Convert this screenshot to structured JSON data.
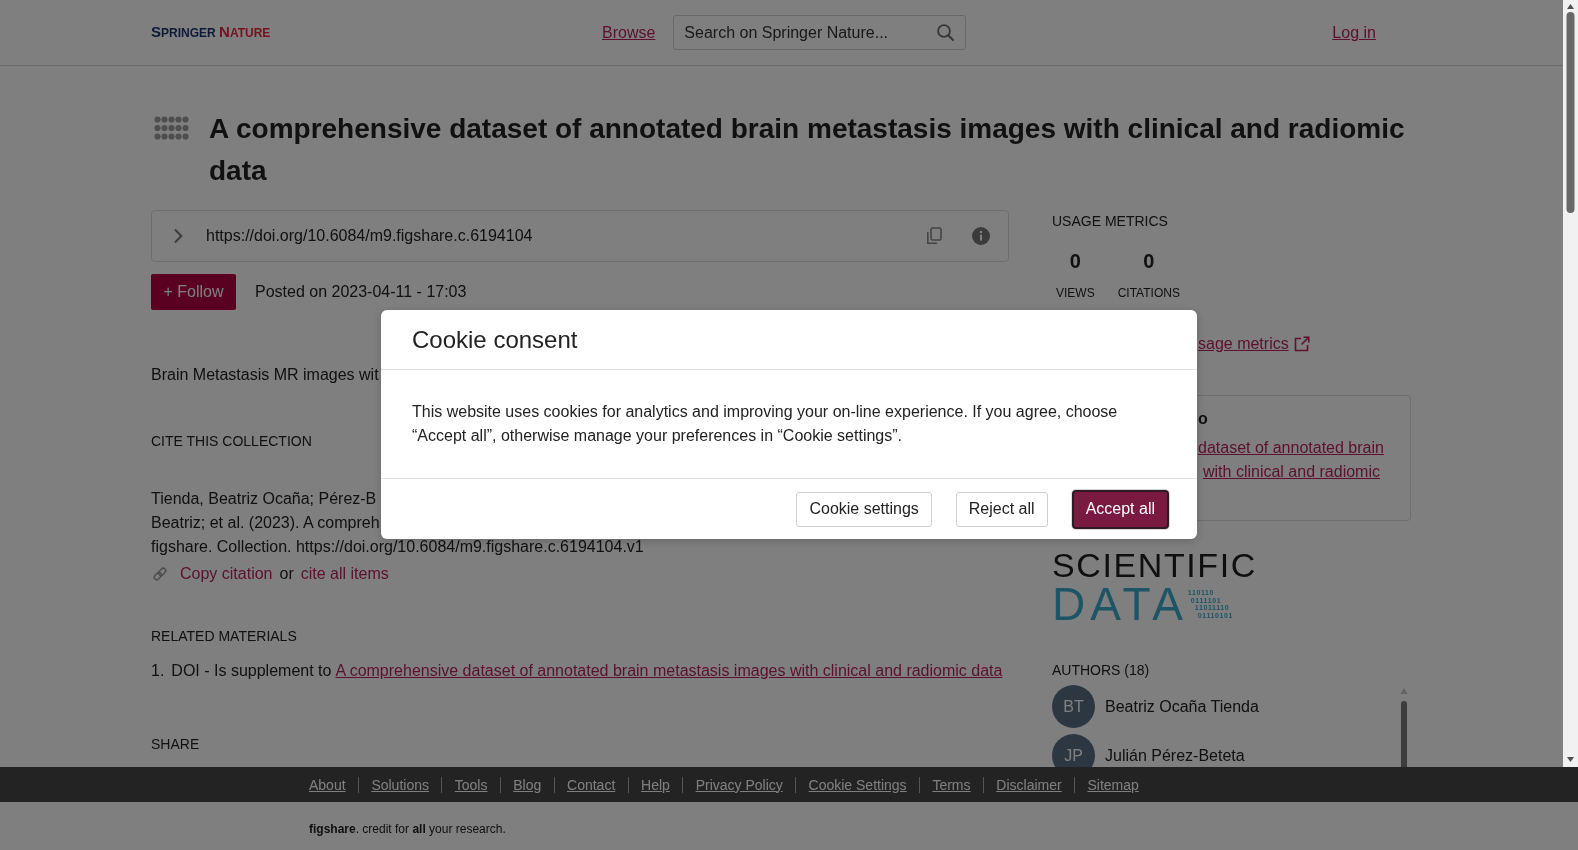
{
  "header": {
    "logo": [
      "SPRINGER",
      "NATURE"
    ],
    "browse_link": "Browse",
    "search": {
      "placeholder": "Search on Springer Nature..."
    },
    "login_link": "Log in"
  },
  "title": "A comprehensive dataset of annotated brain metastasis images with clinical and radiomic data",
  "doi_bar": {
    "url": "https://doi.org/10.6084/m9.figshare.c.6194104"
  },
  "follow_button": "+ Follow",
  "posted": "Posted on 2023-04-11 - 17:03",
  "description": "Brain Metastasis MR images wit",
  "cite": {
    "heading": "CITE THIS COLLECTION",
    "lines": [
      "Tienda, Beatriz Ocaña; Pérez-B",
      "Beatriz; et al. (2023). A compreh",
      "figshare. Collection. https://doi.org/10.6084/m9.figshare.c.6194104.v1"
    ],
    "copy_link": "Copy citation",
    "or": "or",
    "cite_all_link": "cite all items"
  },
  "related_materials": {
    "heading": "RELATED MATERIALS",
    "items": [
      {
        "number": "1.",
        "relation": "DOI - Is supplement to",
        "link": "A comprehensive dataset of annotated brain metastasis images with clinical and radiomic data"
      }
    ]
  },
  "share": {
    "heading": "SHARE"
  },
  "usage_metrics": {
    "heading": "USAGE METRICS",
    "metrics": [
      {
        "value": "0",
        "label": "VIEWS"
      },
      {
        "value": "0",
        "label": "CITATIONS"
      }
    ],
    "link": "sage metrics"
  },
  "related_card": {
    "heading": "o",
    "links": [
      "dataset of annotated brain",
      "with clinical and radiomic"
    ]
  },
  "journal_logo": {
    "top": "SCIENTIFIC",
    "bottom": "DATA",
    "binary": [
      "110110",
      "0111101",
      "11011110",
      "01110101"
    ]
  },
  "authors": {
    "heading": "AUTHORS (18)",
    "items": [
      {
        "initials": "BT",
        "name": "Beatriz Ocaña Tienda"
      },
      {
        "initials": "JP",
        "name": "Julián Pérez-Beteta"
      }
    ]
  },
  "footer": {
    "links": [
      "About",
      "Solutions",
      "Tools",
      "Blog",
      "Contact",
      "Help",
      "Privacy Policy",
      "Cookie Settings",
      "Terms",
      "Disclaimer",
      "Sitemap"
    ],
    "tagline": "**figshare**. credit for **all** your research."
  },
  "cookie_dialog": {
    "title": "Cookie consent",
    "text": "This website uses cookies for analytics and improving your on-line experience. If you agree, choose “Accept all”, otherwise manage your preferences in “Cookie settings”.",
    "buttons": [
      {
        "label": "Cookie settings",
        "kind": "secondary"
      },
      {
        "label": "Reject all",
        "kind": "secondary"
      },
      {
        "label": "Accept all",
        "kind": "primary"
      }
    ]
  }
}
